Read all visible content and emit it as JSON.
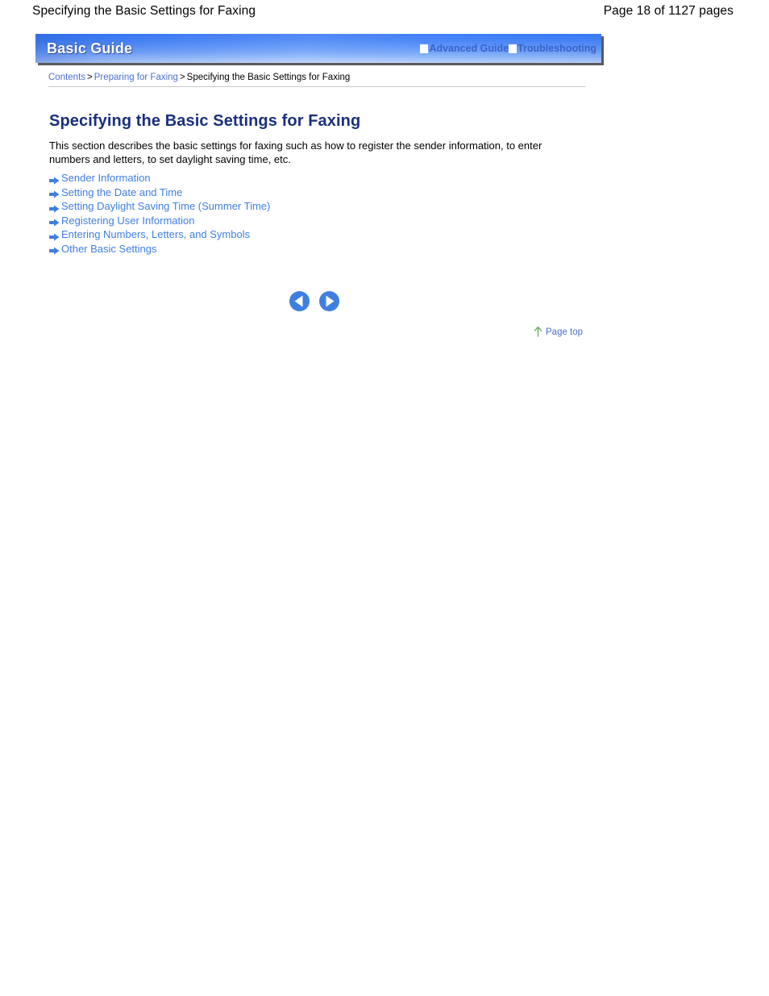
{
  "print_header": {
    "title": "Specifying the Basic Settings for Faxing",
    "page_info": "Page 18 of 1127 pages"
  },
  "guide_bar": {
    "title": "Basic Guide",
    "links": [
      {
        "label": "Advanced Guide",
        "icon": "white-square-icon"
      },
      {
        "label": "Troubleshooting",
        "icon": "white-square-icon"
      }
    ]
  },
  "breadcrumb": {
    "items": [
      {
        "label": "Contents",
        "is_link": true
      },
      {
        "label": "Preparing for Faxing",
        "is_link": true
      },
      {
        "label": "Specifying the Basic Settings for Faxing",
        "is_link": false
      }
    ],
    "separator": ">"
  },
  "content": {
    "page_title": "Specifying the Basic Settings for Faxing",
    "intro": "This section describes the basic settings for faxing such as how to register the sender information, to enter numbers and letters, to set daylight saving time, etc.",
    "links": [
      {
        "label": "Sender Information",
        "icon": "arrow-right-icon"
      },
      {
        "label": "Setting the Date and Time",
        "icon": "arrow-right-icon"
      },
      {
        "label": "Setting Daylight Saving Time (Summer Time)",
        "icon": "arrow-right-icon"
      },
      {
        "label": "Registering User Information",
        "icon": "arrow-right-icon"
      },
      {
        "label": "Entering Numbers, Letters, and Symbols",
        "icon": "arrow-right-icon"
      },
      {
        "label": "Other Basic Settings",
        "icon": "arrow-right-icon"
      }
    ]
  },
  "navigation": {
    "previous": {
      "icon": "circle-left-arrow-icon",
      "label": "Previous"
    },
    "next": {
      "icon": "circle-right-arrow-icon",
      "label": "Next"
    }
  },
  "page_top": {
    "label": "Page top",
    "icon": "arrow-up-icon"
  },
  "colors": {
    "bar_blue_dark": "#3c7bf6",
    "bar_blue_light": "#bcd3fc",
    "heading_navy": "#19307e",
    "link_blue": "#3f7fe0",
    "breadcrumb_blue": "#4a6fd0",
    "bar_link_blue": "#3a63c8",
    "page_top_green": "#5aa84f",
    "rule_gray": "#c9c9c9",
    "background": "#ffffff"
  }
}
